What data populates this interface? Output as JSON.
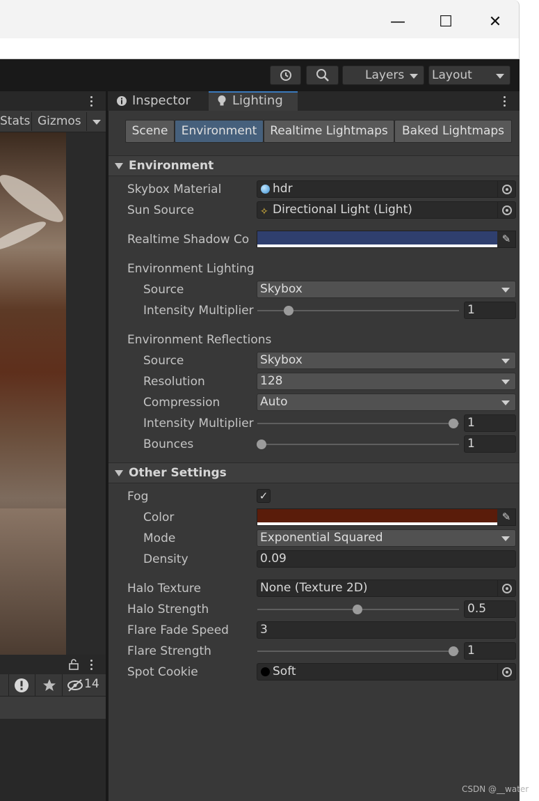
{
  "window": {
    "minimize_glyph": "—",
    "maximize_glyph": "☐",
    "close_glyph": "✕"
  },
  "toolbar": {
    "history_icon": "history-icon",
    "search_icon": "search-icon",
    "layers_label": "Layers",
    "layout_label": "Layout"
  },
  "scene": {
    "stats_label": "Stats",
    "gizmos_label": "Gizmos",
    "console_hidden_count": "14"
  },
  "tabs": {
    "inspector": "Inspector",
    "lighting": "Lighting"
  },
  "segments": [
    "Scene",
    "Environment",
    "Realtime Lightmaps",
    "Baked Lightmaps"
  ],
  "environment": {
    "section_title": "Environment",
    "skybox_material_label": "Skybox Material",
    "skybox_material_value": "hdr",
    "sun_source_label": "Sun Source",
    "sun_source_value": "Directional Light (Light)",
    "realtime_shadow_label": "Realtime Shadow Co",
    "realtime_shadow_color": "#2f3f6e",
    "env_lighting_label": "Environment Lighting",
    "lighting_source_label": "Source",
    "lighting_source_value": "Skybox",
    "lighting_intensity_label": "Intensity Multiplier",
    "lighting_intensity_value": "1",
    "lighting_intensity_fraction": 0.14,
    "env_reflections_label": "Environment Reflections",
    "reflection_source_label": "Source",
    "reflection_source_value": "Skybox",
    "resolution_label": "Resolution",
    "resolution_value": "128",
    "compression_label": "Compression",
    "compression_value": "Auto",
    "reflection_intensity_label": "Intensity Multiplier",
    "reflection_intensity_value": "1",
    "reflection_intensity_fraction": 1.0,
    "bounces_label": "Bounces",
    "bounces_value": "1",
    "bounces_fraction": 0.0
  },
  "other": {
    "section_title": "Other Settings",
    "fog_label": "Fog",
    "fog_checked": "✓",
    "color_label": "Color",
    "fog_color": "#5a1c0a",
    "mode_label": "Mode",
    "mode_value": "Exponential Squared",
    "density_label": "Density",
    "density_value": "0.09",
    "halo_texture_label": "Halo Texture",
    "halo_texture_value": "None (Texture 2D)",
    "halo_strength_label": "Halo Strength",
    "halo_strength_value": "0.5",
    "halo_strength_fraction": 0.5,
    "flare_fade_label": "Flare Fade Speed",
    "flare_fade_value": "3",
    "flare_strength_label": "Flare Strength",
    "flare_strength_value": "1",
    "flare_strength_fraction": 1.0,
    "spot_cookie_label": "Spot Cookie",
    "spot_cookie_value": "Soft"
  },
  "watermark": "CSDN @__water",
  "colors": {
    "accent_tab": "#3a79bb",
    "active_segment": "#46607c",
    "panel_bg": "#383838"
  }
}
